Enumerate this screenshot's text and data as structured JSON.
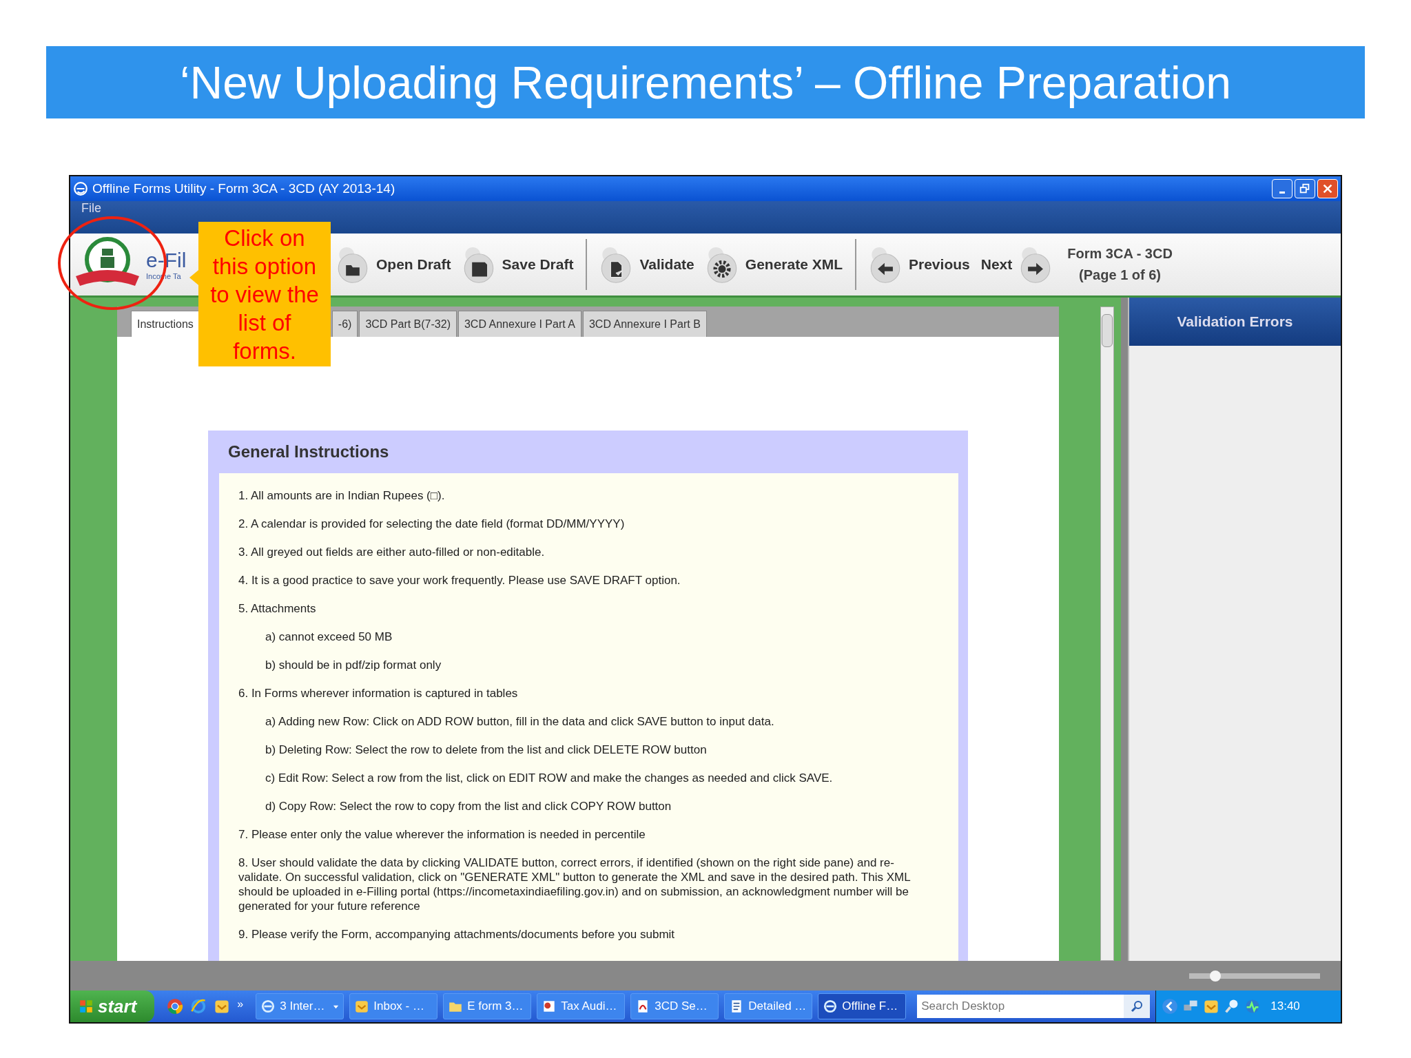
{
  "slide_title": "‘New Uploading Requirements’ – Offline Preparation",
  "window": {
    "title": "Offline Forms Utility - Form 3CA - 3CD (AY 2013-14)"
  },
  "menu": [
    "File"
  ],
  "brand": {
    "name": "e-Fil",
    "subtitle": "Income Ta"
  },
  "toolbar_groups": [
    [
      {
        "label": "Open Draft"
      },
      {
        "label": "Save Draft"
      }
    ],
    [
      {
        "label": "Validate"
      },
      {
        "label": "Generate XML"
      }
    ],
    [
      {
        "label": "Previous"
      },
      {
        "label": "Next"
      }
    ]
  ],
  "form_info": {
    "form": "Form 3CA - 3CD",
    "page": "(Page 1 of 6)"
  },
  "tabs": [
    {
      "label": "Instructions",
      "selected": true
    },
    {
      "label": "-6)",
      "selected": false
    },
    {
      "label": "3CD Part B(7-32)",
      "selected": false
    },
    {
      "label": "3CD Annexure I Part A",
      "selected": false
    },
    {
      "label": "3CD Annexure I Part B",
      "selected": false
    }
  ],
  "instructions": {
    "title": "General Instructions",
    "items": [
      {
        "text": "1. All amounts are in Indian Rupees (□)."
      },
      {
        "text": "2. A calendar is provided for selecting the date field (format DD/MM/YYYY)"
      },
      {
        "text": "3. All greyed out fields are either auto-filled or non-editable."
      },
      {
        "text": "4. It is a good practice to save your work frequently. Please use SAVE DRAFT option."
      },
      {
        "text": "5. Attachments",
        "children": [
          {
            "text": "a) cannot exceed 50 MB"
          },
          {
            "text": "b) should be in pdf/zip format only"
          }
        ]
      },
      {
        "text": "6. In Forms wherever information is captured in tables",
        "children": [
          {
            "text": "a) Adding new Row: Click on ADD ROW button, fill in the data and click SAVE button to input data."
          },
          {
            "text": "b) Deleting Row: Select the row to delete from the list and click DELETE ROW button"
          },
          {
            "text": "c) Edit Row: Select a row from the list, click on EDIT ROW and make the changes as needed and click SAVE."
          },
          {
            "text": "d) Copy Row: Select the row to copy from the list and click COPY ROW button"
          }
        ]
      },
      {
        "text": "7. Please enter only the value wherever the information is needed in percentile"
      },
      {
        "text": "8. User should validate the data by clicking VALIDATE button, correct errors, if identified (shown on the right side pane) and re-validate. On successful validation, click on \"GENERATE XML\" button to generate the XML and save in the desired path. This XML should be uploaded in e-Filling portal (https://incometaxindiaefiling.gov.in) and on submission, an acknowledgment number will be generated for your future reference"
      },
      {
        "text": "9. Please verify the Form, accompanying attachments/documents before you submit"
      }
    ]
  },
  "side_pane": {
    "title": "Validation Errors"
  },
  "zoom_slider": {
    "level": 0.16
  },
  "callout": "Click on this option to view the list of forms.",
  "taskbar": {
    "start": "start",
    "more": "»",
    "tasks": [
      {
        "label": "3 Inter…",
        "selected": false,
        "dropdown": true
      },
      {
        "label": "Inbox - …",
        "selected": false,
        "dropdown": false
      },
      {
        "label": "E form 3…",
        "selected": false,
        "dropdown": false
      },
      {
        "label": "Tax Audi…",
        "selected": false,
        "dropdown": false
      },
      {
        "label": "3CD Se…",
        "selected": false,
        "dropdown": false
      },
      {
        "label": "Detailed …",
        "selected": false,
        "dropdown": false
      },
      {
        "label": "Offline F…",
        "selected": true,
        "dropdown": false
      }
    ],
    "search": {
      "placeholder": "Search Desktop"
    },
    "clock": "13:40"
  }
}
